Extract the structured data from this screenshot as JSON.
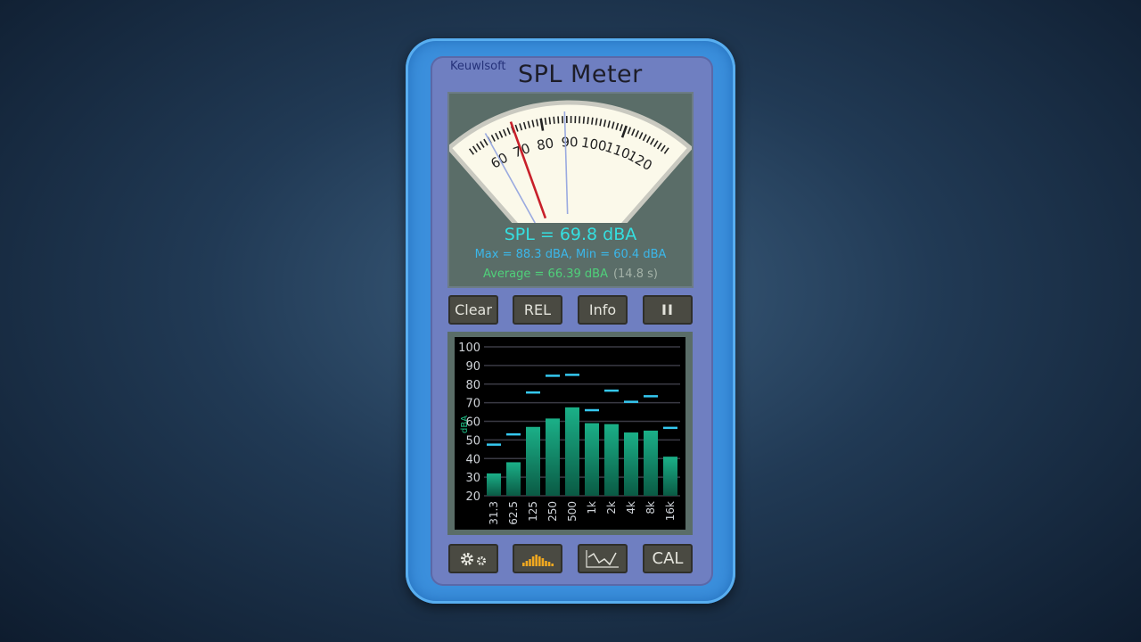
{
  "app": {
    "brand": "Keuwlsoft",
    "title": "SPL Meter"
  },
  "meter": {
    "scale_labels": [
      "60",
      "70",
      "80",
      "90",
      "100",
      "110",
      "120"
    ],
    "current": 69.8,
    "max": 88.3,
    "min": 60.4,
    "needle_color": "#c8202a",
    "minmax_needle_color": "#9aaae0"
  },
  "readout": {
    "spl": "SPL = 69.8 dBA",
    "maxmin": "Max = 88.3 dBA,  Min = 60.4 dBA",
    "average": "Average = 66.39 dBA",
    "time": "(14.8 s)"
  },
  "buttons": {
    "clear": "Clear",
    "rel": "REL",
    "info": "Info",
    "pause": "II",
    "cal": "CAL"
  },
  "bottom_icons": [
    "gears-icon",
    "bar-spectrum-icon",
    "waveform-graph-icon"
  ],
  "chart_data": {
    "type": "bar",
    "ylabel": "dBA",
    "ylim": [
      20,
      100
    ],
    "yticks": [
      "20",
      "30",
      "40",
      "50",
      "60",
      "70",
      "80",
      "90",
      "100"
    ],
    "categories": [
      "31.3",
      "62.5",
      "125",
      "250",
      "500",
      "1k",
      "2k",
      "4k",
      "8k",
      "16k"
    ],
    "series": [
      {
        "values": [
          32,
          38,
          57,
          61.5,
          67.5,
          59,
          58.5,
          54,
          55,
          41
        ],
        "color": "#1a9e78"
      },
      {
        "values": [
          47.5,
          53,
          75.5,
          84.5,
          85,
          66,
          76.5,
          70.5,
          73.5,
          56.5
        ],
        "color": "#35c8f0"
      }
    ],
    "grid": true
  }
}
